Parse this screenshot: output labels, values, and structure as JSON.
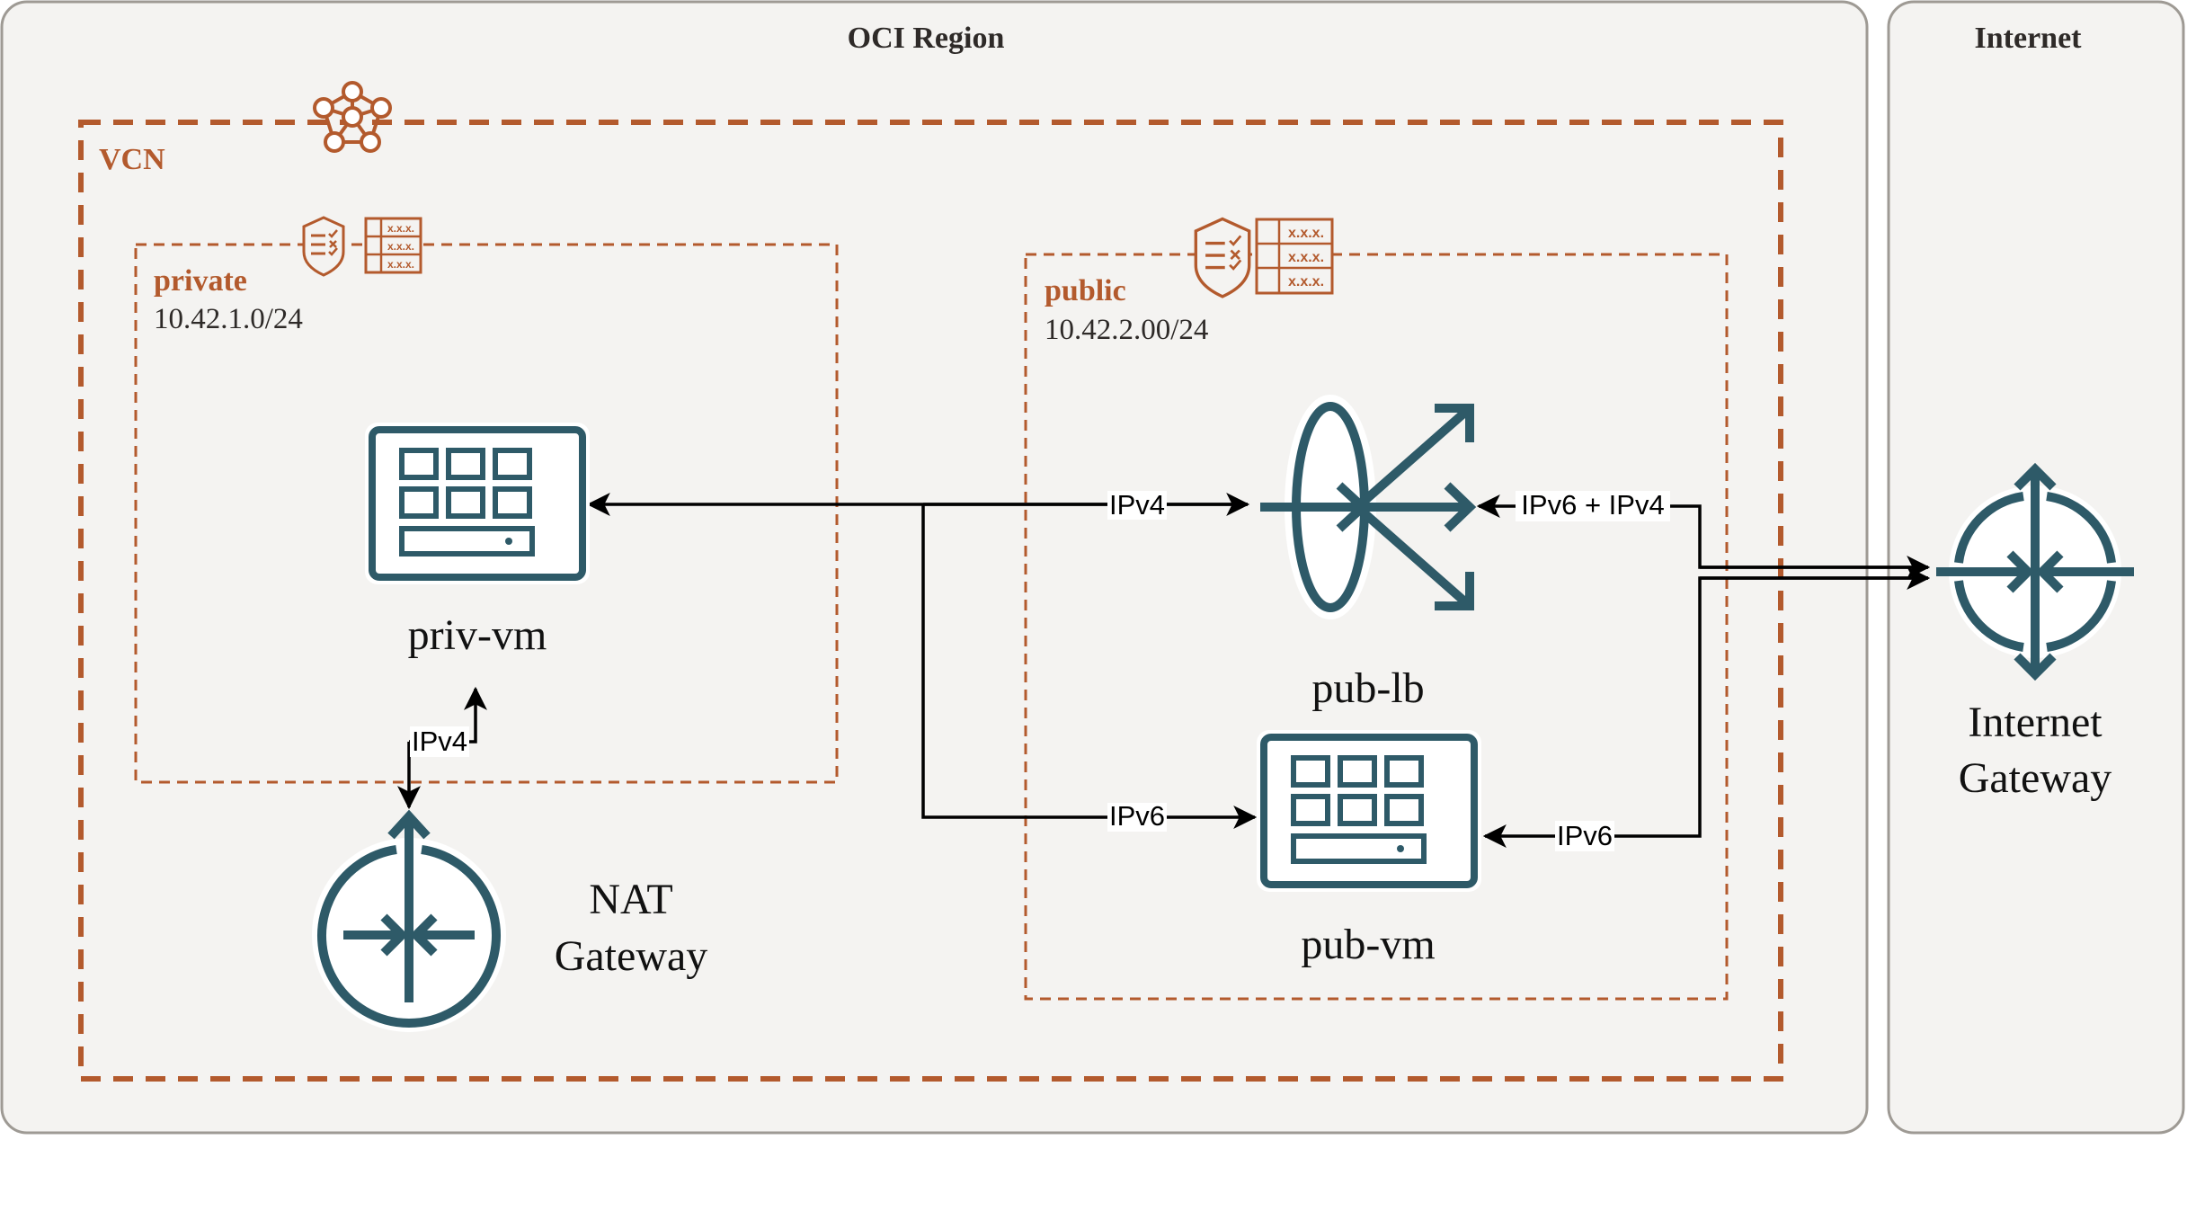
{
  "diagram": {
    "colors": {
      "panel_fill": "#f4f3f1",
      "panel_border": "#9e9a94",
      "oci_orange": "#b35a2d",
      "icon_teal": "#2e5a68",
      "edge": "#000000"
    },
    "regions": {
      "oci_region": {
        "title": "OCI Region"
      },
      "internet": {
        "title": "Internet"
      }
    },
    "vcn": {
      "label": "VCN",
      "icon": "vcn-network-icon"
    },
    "subnets": {
      "private": {
        "name": "private",
        "cidr": "10.42.1.0/24",
        "icons": [
          "security-list-icon",
          "route-table-icon"
        ],
        "route_table_rows": [
          "x.x.x.",
          "x.x.x.",
          "x.x.x."
        ]
      },
      "public": {
        "name": "public",
        "cidr": "10.42.2.00/24",
        "icons": [
          "security-list-icon",
          "route-table-icon"
        ],
        "route_table_rows": [
          "x.x.x.",
          "x.x.x.",
          "x.x.x."
        ]
      }
    },
    "nodes": {
      "priv_vm": {
        "label": "priv-vm",
        "icon": "virtual-machine-icon"
      },
      "nat_gateway": {
        "label_line1": "NAT",
        "label_line2": "Gateway",
        "icon": "nat-gateway-icon"
      },
      "pub_lb": {
        "label": "pub-lb",
        "icon": "load-balancer-icon"
      },
      "pub_vm": {
        "label": "pub-vm",
        "icon": "virtual-machine-icon"
      },
      "internet_gateway": {
        "label_line1": "Internet",
        "label_line2": "Gateway",
        "icon": "internet-gateway-icon"
      }
    },
    "edges": [
      {
        "id": "lb-to-privvm",
        "from": "pub_lb",
        "to": "priv_vm",
        "label": "IPv4"
      },
      {
        "id": "privvm-branch-pubvm",
        "from": "priv_vm",
        "to": "pub_vm",
        "label": "IPv6"
      },
      {
        "id": "igw-to-lb",
        "from": "internet_gateway",
        "to": "pub_lb",
        "label": "IPv6 + IPv4"
      },
      {
        "id": "igw-to-pubvm",
        "from": "internet_gateway",
        "to": "pub_vm",
        "label": "IPv6"
      },
      {
        "id": "privvm-nat",
        "from": "priv_vm",
        "to": "nat_gateway",
        "label": "IPv4"
      }
    ]
  }
}
